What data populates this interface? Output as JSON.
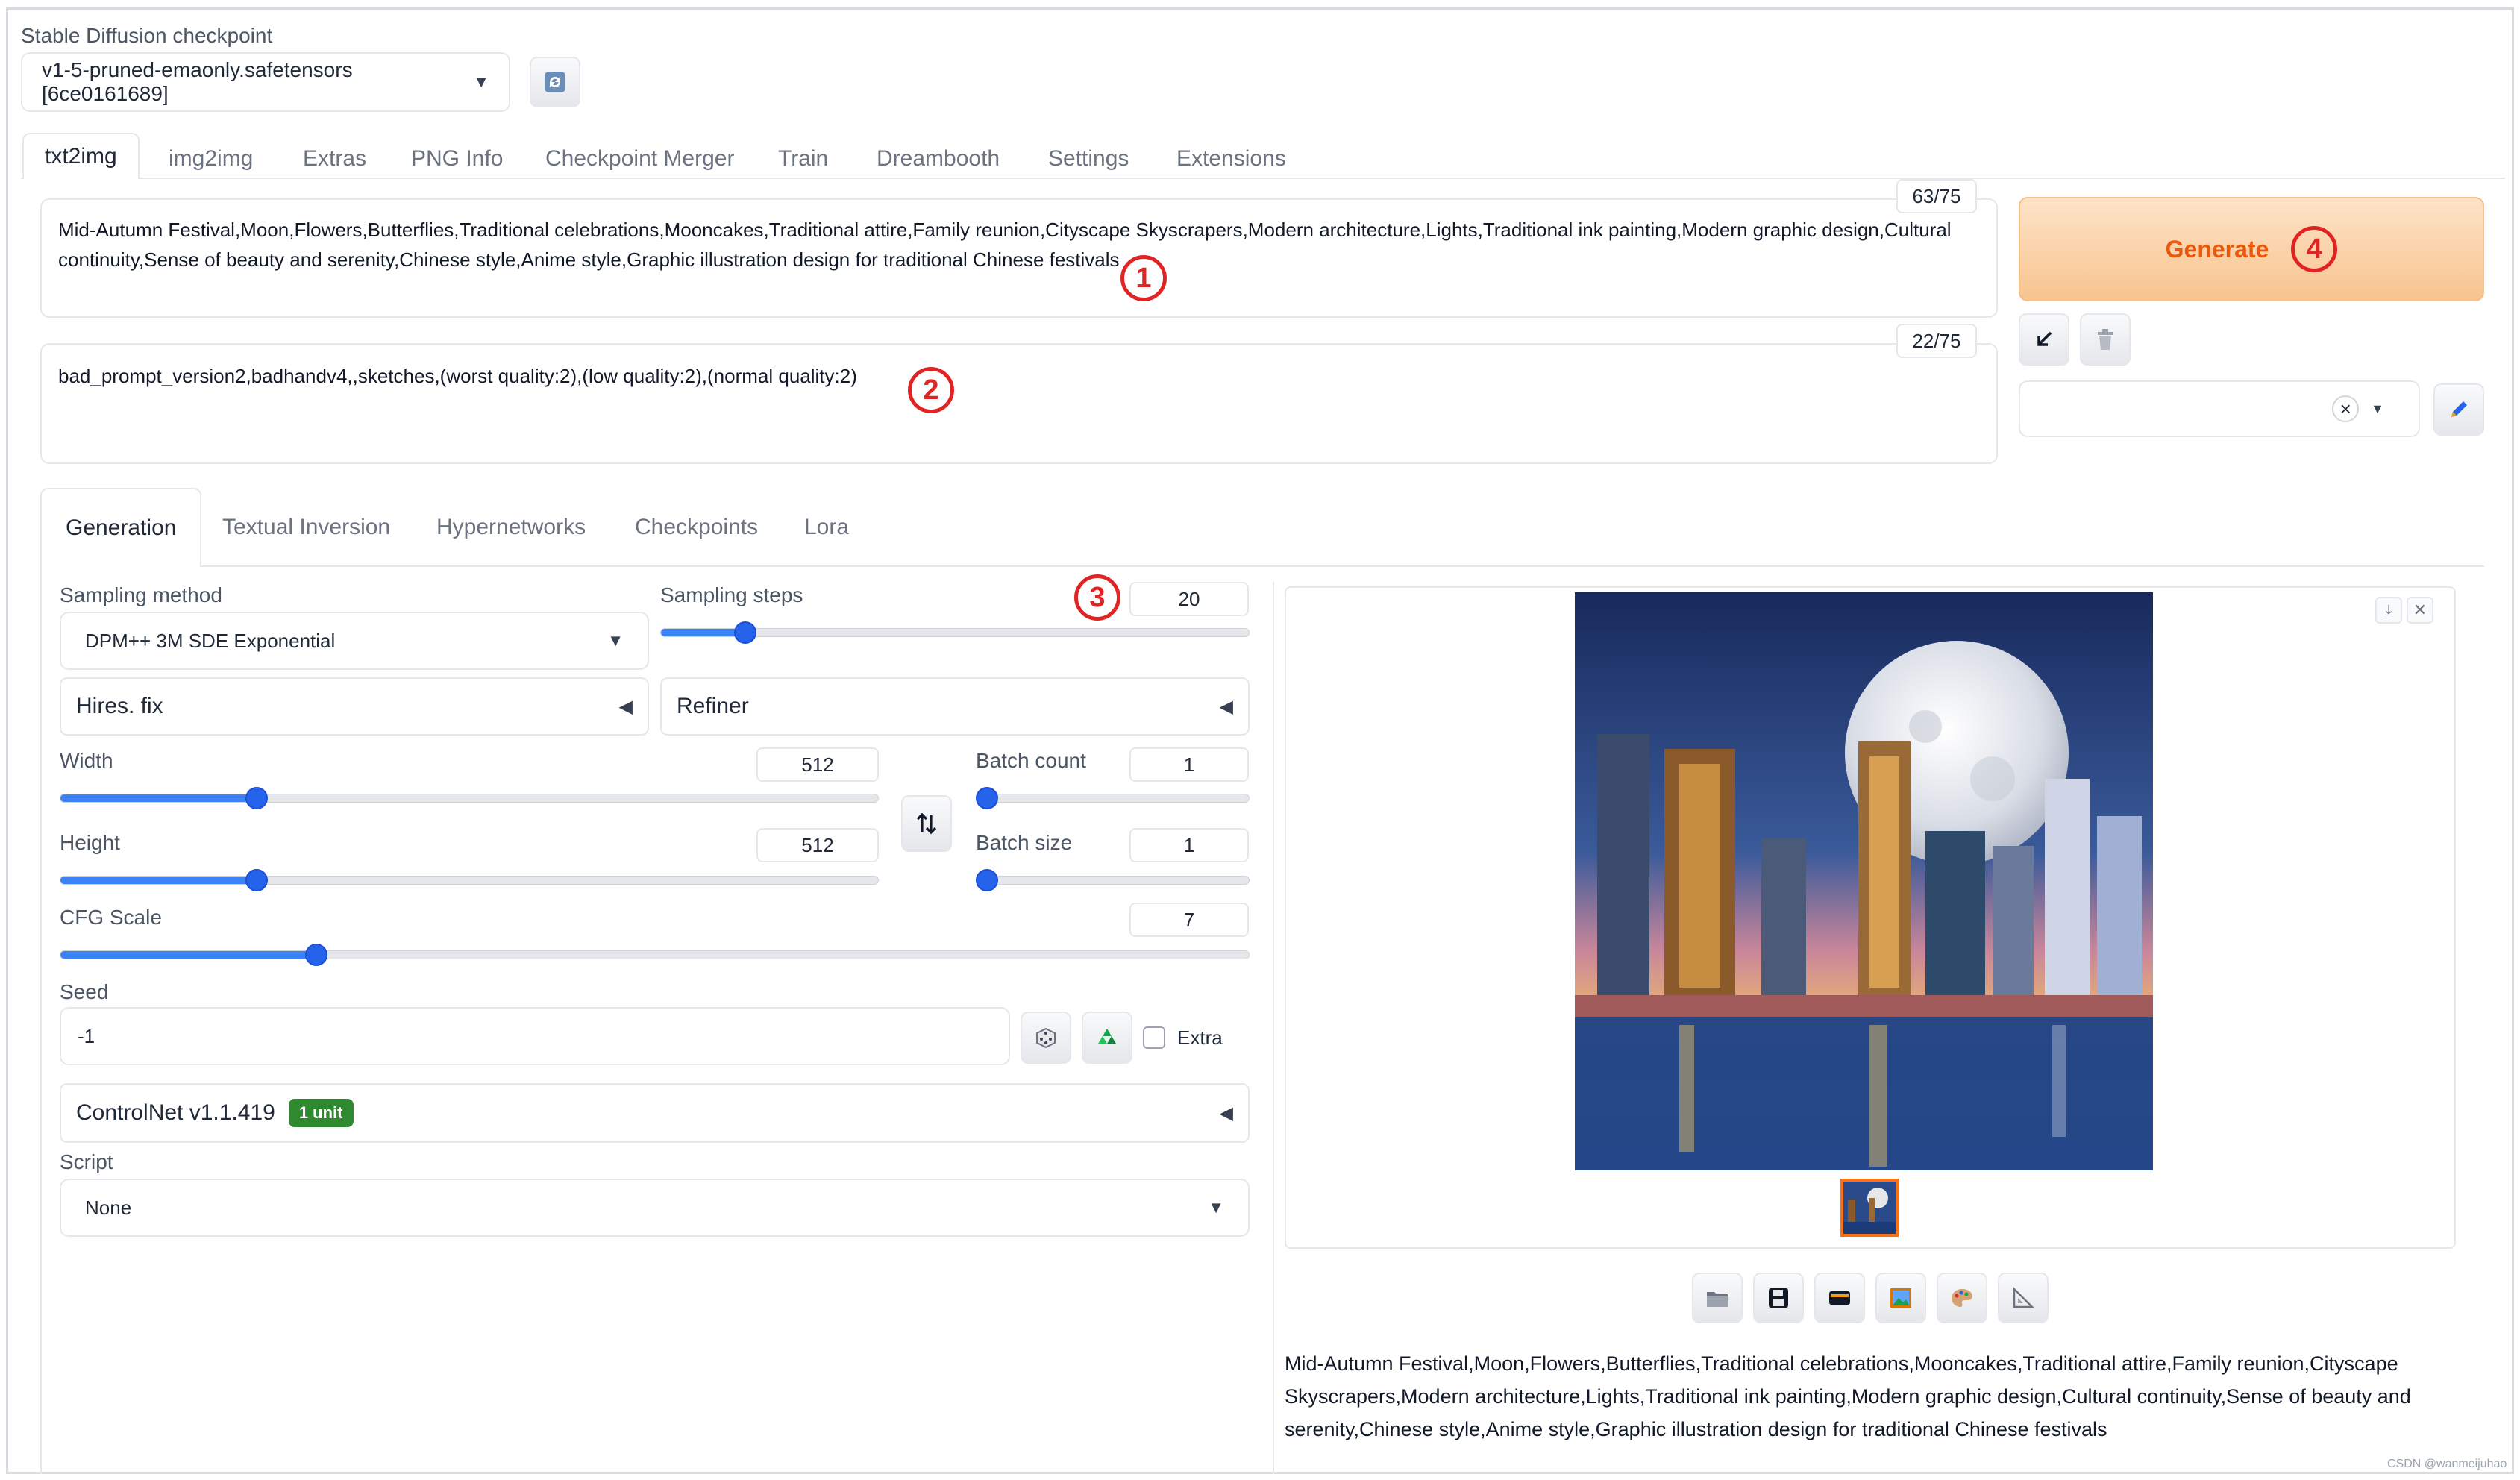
{
  "checkpoint": {
    "label": "Stable Diffusion checkpoint",
    "value": "v1-5-pruned-emaonly.safetensors [6ce0161689]"
  },
  "main_tabs": [
    {
      "label": "txt2img"
    },
    {
      "label": "img2img"
    },
    {
      "label": "Extras"
    },
    {
      "label": "PNG Info"
    },
    {
      "label": "Checkpoint Merger"
    },
    {
      "label": "Train"
    },
    {
      "label": "Dreambooth"
    },
    {
      "label": "Settings"
    },
    {
      "label": "Extensions"
    }
  ],
  "prompt": {
    "text": "Mid-Autumn Festival,Moon,Flowers,Butterflies,Traditional celebrations,Mooncakes,Traditional attire,Family reunion,Cityscape Skyscrapers,Modern architecture,Lights,Traditional ink painting,Modern graphic design,Cultural continuity,Sense of beauty and serenity,Chinese style,Anime style,Graphic illustration design for traditional Chinese festivals",
    "token_count": "63/75",
    "marker": "1"
  },
  "negative_prompt": {
    "text": "bad_prompt_version2,badhandv4,,sketches,(worst quality:2),(low quality:2),(normal quality:2)",
    "token_count": "22/75",
    "marker": "2"
  },
  "generate": {
    "label": "Generate",
    "marker": "4"
  },
  "styles": {
    "clear_glyph": "×"
  },
  "sub_tabs": [
    {
      "label": "Generation"
    },
    {
      "label": "Textual Inversion"
    },
    {
      "label": "Hypernetworks"
    },
    {
      "label": "Checkpoints"
    },
    {
      "label": "Lora"
    }
  ],
  "sampling": {
    "method_label": "Sampling method",
    "method_value": "DPM++ 3M SDE Exponential",
    "steps_label": "Sampling steps",
    "steps_value": "20",
    "steps_fraction": 0.13,
    "marker": "3"
  },
  "hires": {
    "label": "Hires. fix"
  },
  "refiner": {
    "label": "Refiner"
  },
  "width": {
    "label": "Width",
    "value": "512",
    "fraction": 0.233
  },
  "height": {
    "label": "Height",
    "value": "512",
    "fraction": 0.233
  },
  "batch_count": {
    "label": "Batch count",
    "value": "1",
    "fraction": 0.0
  },
  "batch_size": {
    "label": "Batch size",
    "value": "1",
    "fraction": 0.0
  },
  "cfg": {
    "label": "CFG Scale",
    "value": "7",
    "fraction": 0.21
  },
  "seed": {
    "label": "Seed",
    "value": "-1",
    "extra_label": "Extra"
  },
  "controlnet": {
    "label": "ControlNet v1.1.419",
    "badge": "1 unit"
  },
  "script": {
    "label": "Script",
    "value": "None"
  },
  "output": {
    "caption": "Mid-Autumn Festival,Moon,Flowers,Butterflies,Traditional celebrations,Mooncakes,Traditional attire,Family reunion,Cityscape Skyscrapers,Modern architecture,Lights,Traditional ink painting,Modern graphic design,Cultural continuity,Sense of beauty and serenity,Chinese style,Anime style,Graphic illustration design for traditional Chinese festivals"
  },
  "watermark": "CSDN @wanmeijuhao",
  "colors": {
    "accent": "#3b82f6",
    "generate_bg": "#fbd5ac",
    "generate_text": "#ea580c",
    "marker": "#e02424",
    "badge": "#2f8a2f"
  }
}
